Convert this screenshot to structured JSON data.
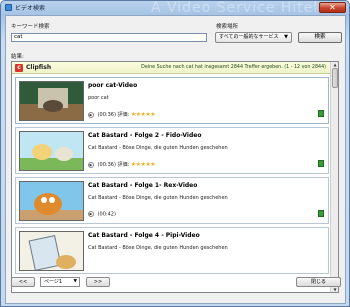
{
  "window": {
    "title": "ビデオ検索",
    "ghost_title": "A Video Service Hitel"
  },
  "search": {
    "keyword_label": "キーワード検索",
    "keyword_value": "cat",
    "location_label": "検索場所",
    "location_selected": "すべての一般的なサービス",
    "search_button": "検索"
  },
  "results_label": "結果:",
  "provider": {
    "name": "Clipfish",
    "info": "Deine Suche nach cat hat insgesamt 2844 Treffer ergeben. (1 - 12 von 2844)"
  },
  "results": [
    {
      "title": "poor cat-Video",
      "desc": "poor cat",
      "duration": "(00:36)",
      "rating_label": "評価:",
      "stars": "★★★★★"
    },
    {
      "title": "Cat Bastard - Folge 2 - Fido-Video",
      "desc": "Cat Bastard - Böse Dinge, die guten Hunden geschehen",
      "duration": "(00:36)",
      "rating_label": "評価:",
      "stars": "★★★★★"
    },
    {
      "title": "Cat Bastard - Folge 1- Rex-Video",
      "desc": "Cat Bastard - Böse Dinge, die guten Hunden geschehen",
      "duration": "(00:42)",
      "rating_label": "",
      "stars": ""
    },
    {
      "title": "Cat Bastard - Folge 4 - Pipi-Video",
      "desc": "Cat Bastard - Böse Dinge, die guten Hunden geschehen",
      "duration": "",
      "rating_label": "",
      "stars": ""
    }
  ],
  "pager": {
    "prev": "<<",
    "page": "ページ1",
    "next": ">>",
    "close": "閉じる"
  },
  "colors": {
    "star": "#f2b01e",
    "provider_bar": "#eef3c8",
    "close": "#c8442b"
  }
}
